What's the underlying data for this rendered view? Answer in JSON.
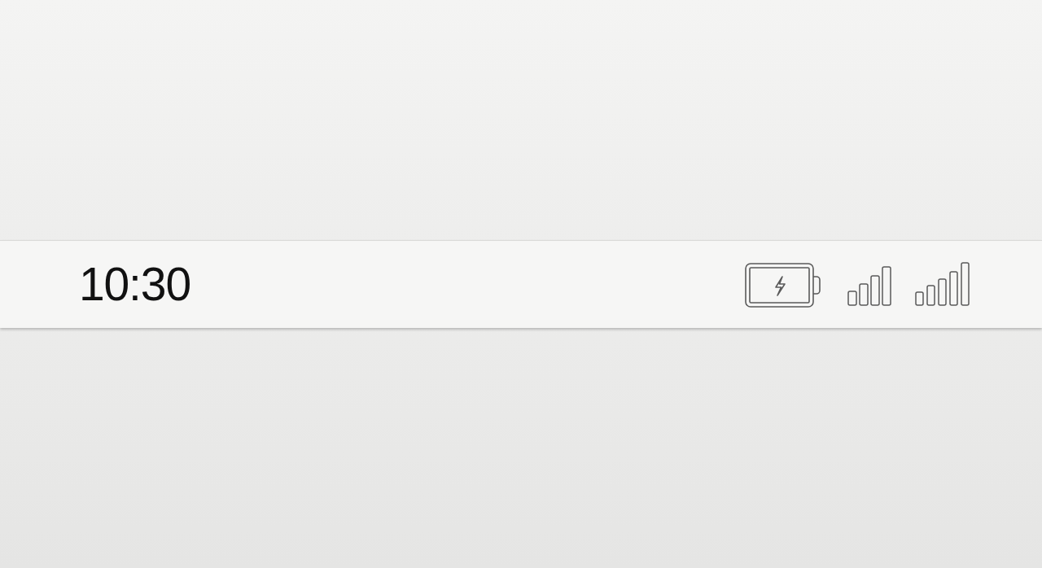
{
  "status_bar": {
    "time": "10:30",
    "battery": {
      "charging": true
    }
  }
}
